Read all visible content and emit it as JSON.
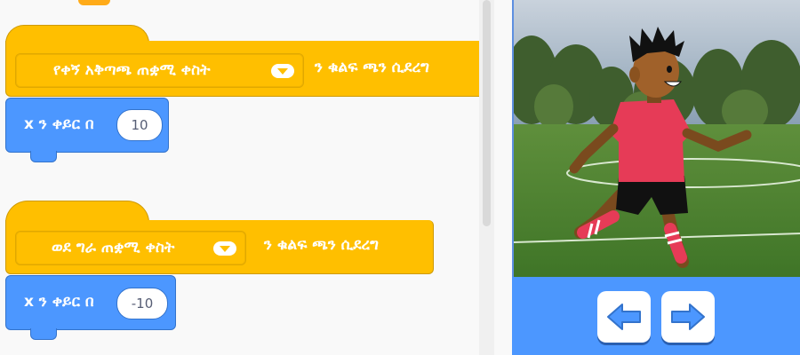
{
  "workspace": {
    "script1": {
      "hat_dropdown_value": "የቀኝ አቅጣጫ ጠቋሚ ቀስት",
      "hat_suffix": "ን ቁልፍ ጫን ሲደረግ",
      "motion_label": "x ን ቀይር በ",
      "motion_value": "10"
    },
    "script2": {
      "hat_dropdown_value": "ወደ ግራ ጠቋሚ ቀስት",
      "hat_suffix": "ን ቁልፍ ጫን ሲደረግ",
      "motion_label": "x ን ቀይር በ",
      "motion_value": "-10"
    }
  },
  "stage": {
    "scene": "soccer field with player sprite",
    "buttons": [
      {
        "name": "left-arrow",
        "icon": "arrow-left-icon"
      },
      {
        "name": "right-arrow",
        "icon": "arrow-right-icon"
      }
    ]
  },
  "colors": {
    "events_block": "#ffbf00",
    "motion_block": "#4c97ff",
    "stage_controls": "#4c97ff",
    "arrow_icon": "#4c97ff"
  }
}
